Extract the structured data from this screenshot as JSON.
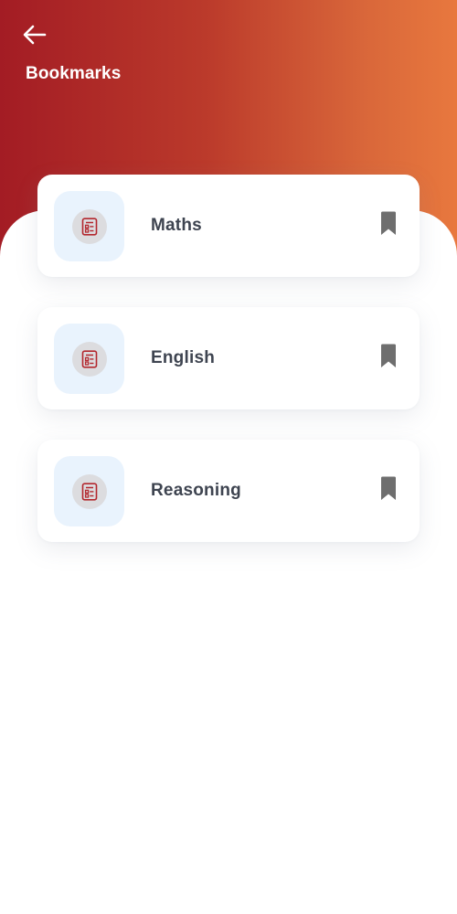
{
  "header": {
    "title": "Bookmarks",
    "back_icon": "arrow-left-icon"
  },
  "colors": {
    "gradient_start": "#a31c24",
    "gradient_end": "#e8783e",
    "card_icon_bg": "#e9f3fd",
    "doc_icon": "#b3282f",
    "bookmark_icon": "#6e6e6e",
    "label_text": "#3e4450"
  },
  "bookmarks": [
    {
      "label": "Maths",
      "icon": "document-icon",
      "action_icon": "bookmark-icon"
    },
    {
      "label": "English",
      "icon": "document-icon",
      "action_icon": "bookmark-icon"
    },
    {
      "label": "Reasoning",
      "icon": "document-icon",
      "action_icon": "bookmark-icon"
    }
  ]
}
